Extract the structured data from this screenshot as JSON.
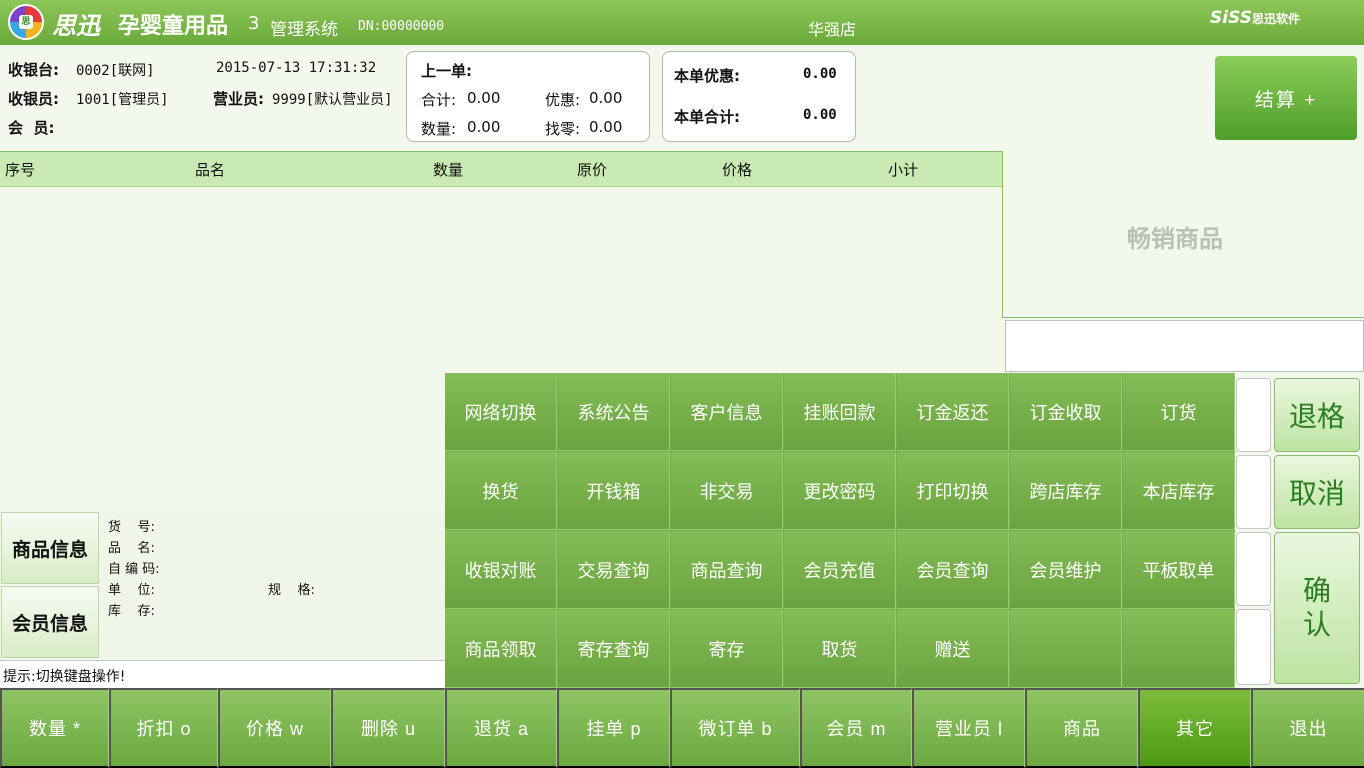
{
  "title": {
    "brand": "思迅",
    "product": "孕婴童用品",
    "version": "3",
    "system": "管理系统",
    "dn": "DN:00000000",
    "store": "华强店",
    "vendor_brand": "SiSS",
    "vendor_name": "思迅软件"
  },
  "info": {
    "register_label": "收银台:",
    "register_value": "0002[联网]",
    "datetime": "2015-07-13 17:31:32",
    "cashier_label": "收银员:",
    "cashier_value": "1001[管理员]",
    "clerk_label": "营业员:",
    "clerk_value": "9999[默认营业员]",
    "member_label": "会  员:"
  },
  "last_order": {
    "title": "上一单:",
    "total_label": "合计:",
    "total": "0.00",
    "discount_label": "优惠:",
    "discount": "0.00",
    "qty_label": "数量:",
    "qty": "0.00",
    "change_label": "找零:",
    "change": "0.00"
  },
  "current": {
    "discount_label": "本单优惠:",
    "discount": "0.00",
    "total_label": "本单合计:",
    "total": "0.00"
  },
  "settle_label": "结算 +",
  "table_headers": [
    "序号",
    "品名",
    "数量",
    "原价",
    "价格",
    "小计"
  ],
  "bestseller_label": "畅销商品",
  "right_buttons": {
    "backspace": "退格",
    "cancel": "取消",
    "confirm_1": "确",
    "confirm_2": "认"
  },
  "product_tabs": {
    "product": "商品信息",
    "member": "会员信息"
  },
  "product_fields": {
    "sku": "货    号:",
    "name": "品    名:",
    "code": "自 编 码:",
    "unit": "单    位:",
    "spec": "规    格:",
    "stock": "库    存:"
  },
  "hint": "提示:切换键盘操作!",
  "menu": [
    [
      "网络切换",
      "系统公告",
      "客户信息",
      "挂账回款",
      "订金返还",
      "订金收取",
      "订货"
    ],
    [
      "换货",
      "开钱箱",
      "非交易",
      "更改密码",
      "打印切换",
      "跨店库存",
      "本店库存"
    ],
    [
      "收银对账",
      "交易查询",
      "商品查询",
      "会员充值",
      "会员查询",
      "会员维护",
      "平板取单"
    ],
    [
      "商品领取",
      "寄存查询",
      "寄存",
      "取货",
      "赠送",
      "",
      ""
    ]
  ],
  "bottom": {
    "qty": "数量 *",
    "discount": "折扣 o",
    "price": "价格 w",
    "delete": "删除 u",
    "return": "退货 a",
    "hold": "挂单 p",
    "micro_order": "微订单 b",
    "member": "会员 m",
    "clerk": "营业员 l",
    "product": "商品",
    "other": "其它",
    "exit": "退出"
  }
}
